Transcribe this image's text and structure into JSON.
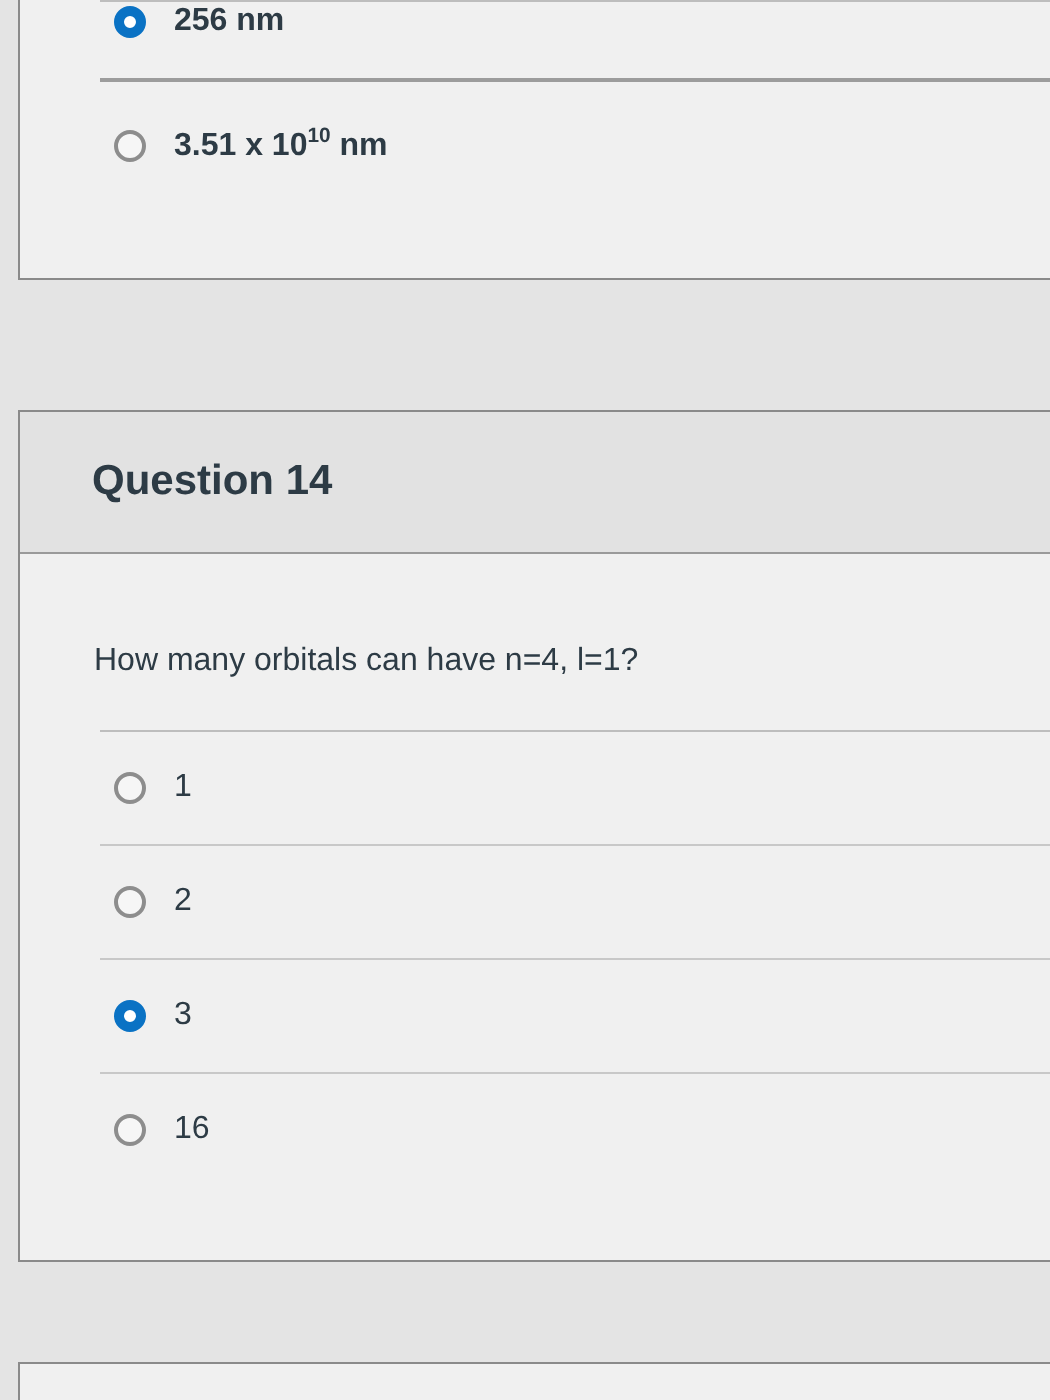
{
  "previous_question": {
    "answers": [
      {
        "label": "256 nm",
        "selected": true
      },
      {
        "label": "3.51 x 10$^{10}$ nm",
        "selected": false
      }
    ]
  },
  "question": {
    "title": "Question 14",
    "text": "How many orbitals can have n=4, l=1?",
    "answers": [
      {
        "label": "1",
        "selected": false
      },
      {
        "label": "2",
        "selected": false
      },
      {
        "label": "3",
        "selected": true
      },
      {
        "label": "16",
        "selected": false
      }
    ]
  }
}
